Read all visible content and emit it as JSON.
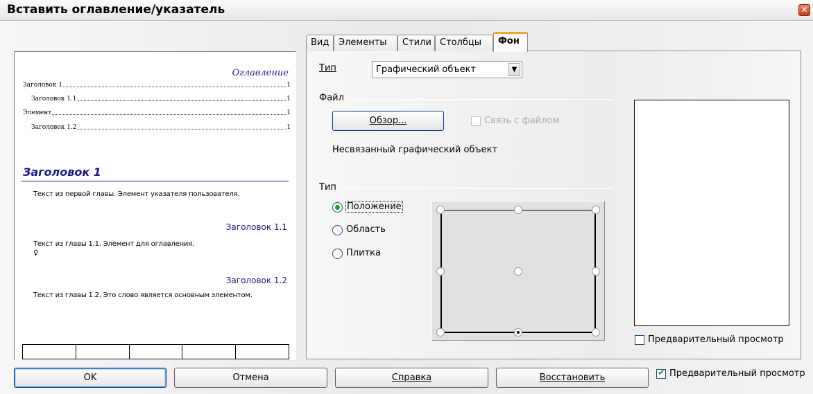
{
  "window": {
    "title": "Вставить оглавление/указатель",
    "close_glyph": "✕"
  },
  "preview": {
    "toc_title": "Оглавление",
    "toc_entries": [
      {
        "text": "Заголовок 1",
        "page": "1"
      },
      {
        "text": "Заголовок 1.1",
        "page": "1"
      },
      {
        "text": "Элемент",
        "page": "1"
      },
      {
        "text": "Заголовок 1.2",
        "page": "1"
      }
    ],
    "heading1": "Заголовок 1",
    "text1": "Текст из первой главы. Элемент указателя пользователя.",
    "heading11": "Заголовок 1.1",
    "text11": "Текст из главы 1.1. Элемент для оглавления.",
    "text11_mark": "♀",
    "heading12": "Заголовок 1.2",
    "text12": "Текст из главы 1.2. Это слово является основным элементом."
  },
  "tabs": [
    "Вид",
    "Элементы",
    "Стили",
    "Столбцы",
    "Фон"
  ],
  "active_tab": "Фон",
  "background": {
    "type_label": "Тип",
    "type_value": "Графический объект",
    "file_section": "Файл",
    "browse_button": "Обзор...",
    "link_checkbox": "Связь с файлом",
    "link_checked": false,
    "unlinked_text": "Несвязанный графический объект",
    "type_section": "Тип",
    "radios": [
      {
        "label": "Положение",
        "selected": true
      },
      {
        "label": "Область",
        "selected": false
      },
      {
        "label": "Плитка",
        "selected": false
      }
    ],
    "preview_checkbox": "Предварительный просмотр",
    "preview_checked": false
  },
  "footer": {
    "ok": "OK",
    "cancel": "Отмена",
    "help": "Справка",
    "reset": "Восстановить",
    "preview_checkbox": "Предварительный просмотр",
    "preview_checked": true
  },
  "colors": {
    "accent_tab": "#f3a52e",
    "heading_blue": "#1a1a8c",
    "check_green": "#21a121"
  }
}
